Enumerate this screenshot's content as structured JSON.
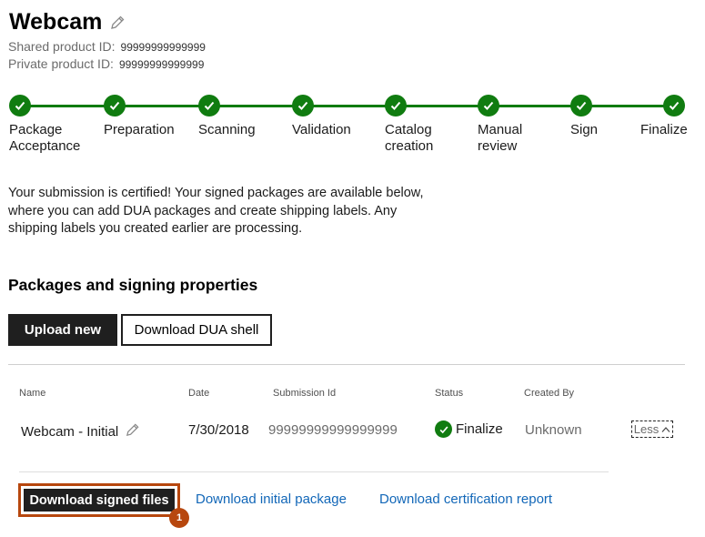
{
  "product": {
    "title": "Webcam",
    "shared_id_label": "Shared product ID:",
    "shared_id_value": "99999999999999",
    "private_id_label": "Private product ID:",
    "private_id_value": "99999999999999"
  },
  "steps": [
    {
      "line1": "Package",
      "line2": "Acceptance",
      "state": "complete"
    },
    {
      "line1": "Preparation",
      "line2": "",
      "state": "complete"
    },
    {
      "line1": "Scanning",
      "line2": "",
      "state": "complete"
    },
    {
      "line1": "Validation",
      "line2": "",
      "state": "complete"
    },
    {
      "line1": "Catalog",
      "line2": "creation",
      "state": "complete"
    },
    {
      "line1": "Manual",
      "line2": "review",
      "state": "complete"
    },
    {
      "line1": "Sign",
      "line2": "",
      "state": "complete"
    },
    {
      "line1": "Finalize",
      "line2": "",
      "state": "complete"
    }
  ],
  "message": "Your submission is certified! Your signed packages are available below, where you can add DUA packages and create shipping labels. Any shipping labels you created earlier are processing.",
  "section": {
    "title": "Packages and signing properties",
    "upload_label": "Upload new",
    "download_dua_label": "Download DUA shell"
  },
  "table": {
    "headers": {
      "name": "Name",
      "date": "Date",
      "submission_id": "Submission Id",
      "status": "Status",
      "created_by": "Created By"
    },
    "row": {
      "name": "Webcam - Initial",
      "date": "7/30/2018",
      "submission_id": "99999999999999999",
      "status": "Finalize",
      "created_by": "Unknown",
      "toggle_label": "Less"
    }
  },
  "actions": {
    "download_signed": "Download signed files",
    "download_initial": "Download initial package",
    "download_cert": "Download certification report",
    "badge": "1"
  },
  "colors": {
    "success": "#107c10",
    "link": "#1267b8",
    "highlight": "#b7470e",
    "dark_button": "#1f1f1f"
  }
}
